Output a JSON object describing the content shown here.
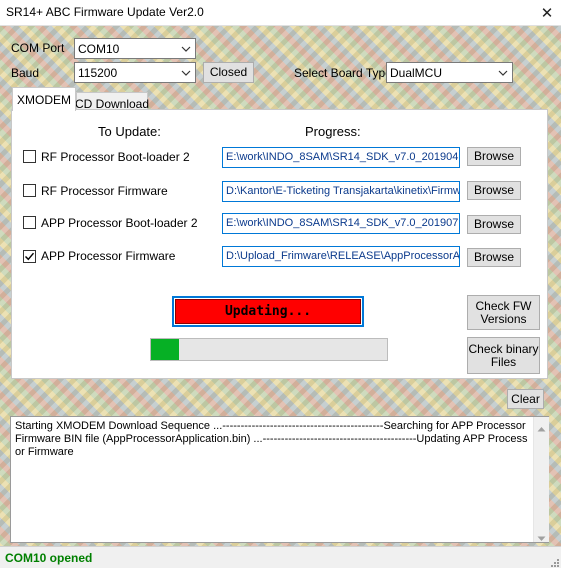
{
  "window": {
    "title": "SR14+ ABC Firmware Update Ver2.0",
    "close_glyph": "✕"
  },
  "connection": {
    "com_port_label": "COM Port",
    "com_port_value": "COM10",
    "baud_label": "Baud",
    "baud_value": "115200",
    "state_button": "Closed",
    "board_label": "Select Board Type",
    "board_value": "DualMCU"
  },
  "tabs": [
    {
      "label": "XMODEM",
      "active": true
    },
    {
      "label": "CD Download",
      "active": false
    }
  ],
  "xmodem": {
    "to_update_header": "To Update:",
    "progress_header": "Progress:",
    "rows": [
      {
        "label": "RF Processor Boot-loader 2",
        "checked": false,
        "path": "E:\\work\\INDO_8SAM\\SR14_SDK_v7.0_201904",
        "browse": "Browse"
      },
      {
        "label": "RF Processor Firmware",
        "checked": false,
        "path": "D:\\Kantor\\E-Ticketing Transjakarta\\kinetix\\Firmw",
        "browse": "Browse"
      },
      {
        "label": "APP Processor Boot-loader 2",
        "checked": false,
        "path": "E:\\work\\INDO_8SAM\\SR14_SDK_v7.0_201907",
        "browse": "Browse"
      },
      {
        "label": "APP Processor Firmware",
        "checked": true,
        "path": "D:\\Upload_Frimware\\RELEASE\\AppProcessorAp",
        "browse": "Browse"
      }
    ],
    "updating_label": "Updating...",
    "progress_fraction": 0.12,
    "check_fw_label": "Check FW Versions",
    "check_bin_label": "Check binary Files"
  },
  "log": {
    "clear_label": "Clear",
    "text": "Starting XMODEM Download Sequence ...--------------------------------------------Searching for APP Processor Firmware BIN file (AppProcessorApplication.bin) ...------------------------------------------Updating APP Processor Firmware"
  },
  "status": {
    "text": "COM10 opened"
  },
  "colors": {
    "updating_bg": "#ff0000",
    "progress_fill": "#06b025",
    "status_text": "#008000",
    "path_border": "#0078d7"
  },
  "icons": {
    "combo_arrow": "chevron-down-icon",
    "check_mark": "check-icon",
    "resize": "resize-grip-icon"
  }
}
